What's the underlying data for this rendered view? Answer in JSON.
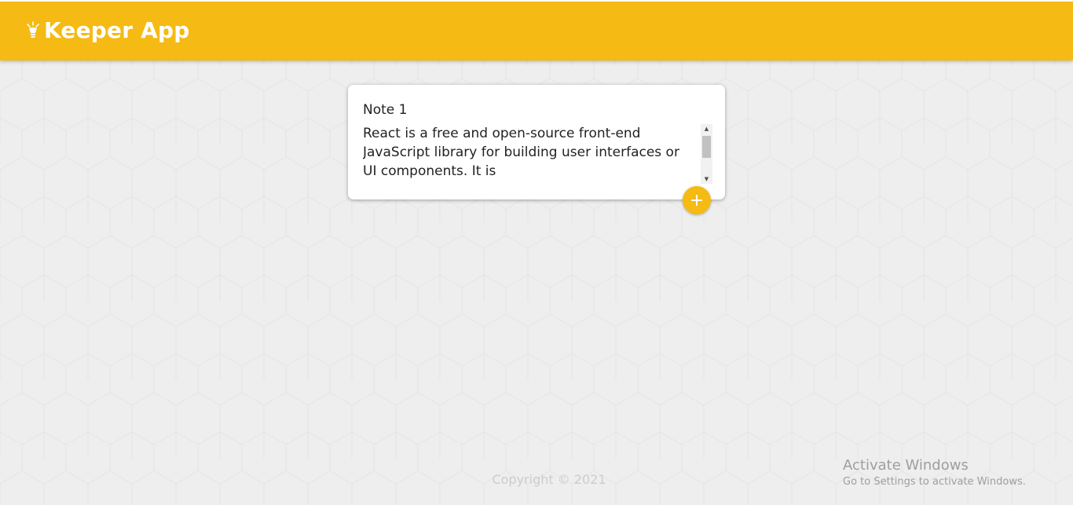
{
  "header": {
    "title": "Keeper App",
    "icon": "bulb-icon",
    "background_color": "#f5ba13"
  },
  "note_form": {
    "title_value": "Note 1",
    "content_value": "React is a free and open-source front-end JavaScript library for building user interfaces or UI components. It is",
    "add_button_icon": "plus-icon"
  },
  "footer": {
    "copyright": "Copyright © 2021"
  },
  "watermark": {
    "title": "Activate Windows",
    "subtitle": "Go to Settings to activate Windows."
  },
  "colors": {
    "accent": "#f5ba13",
    "background": "#eeeeee",
    "card": "#ffffff"
  }
}
